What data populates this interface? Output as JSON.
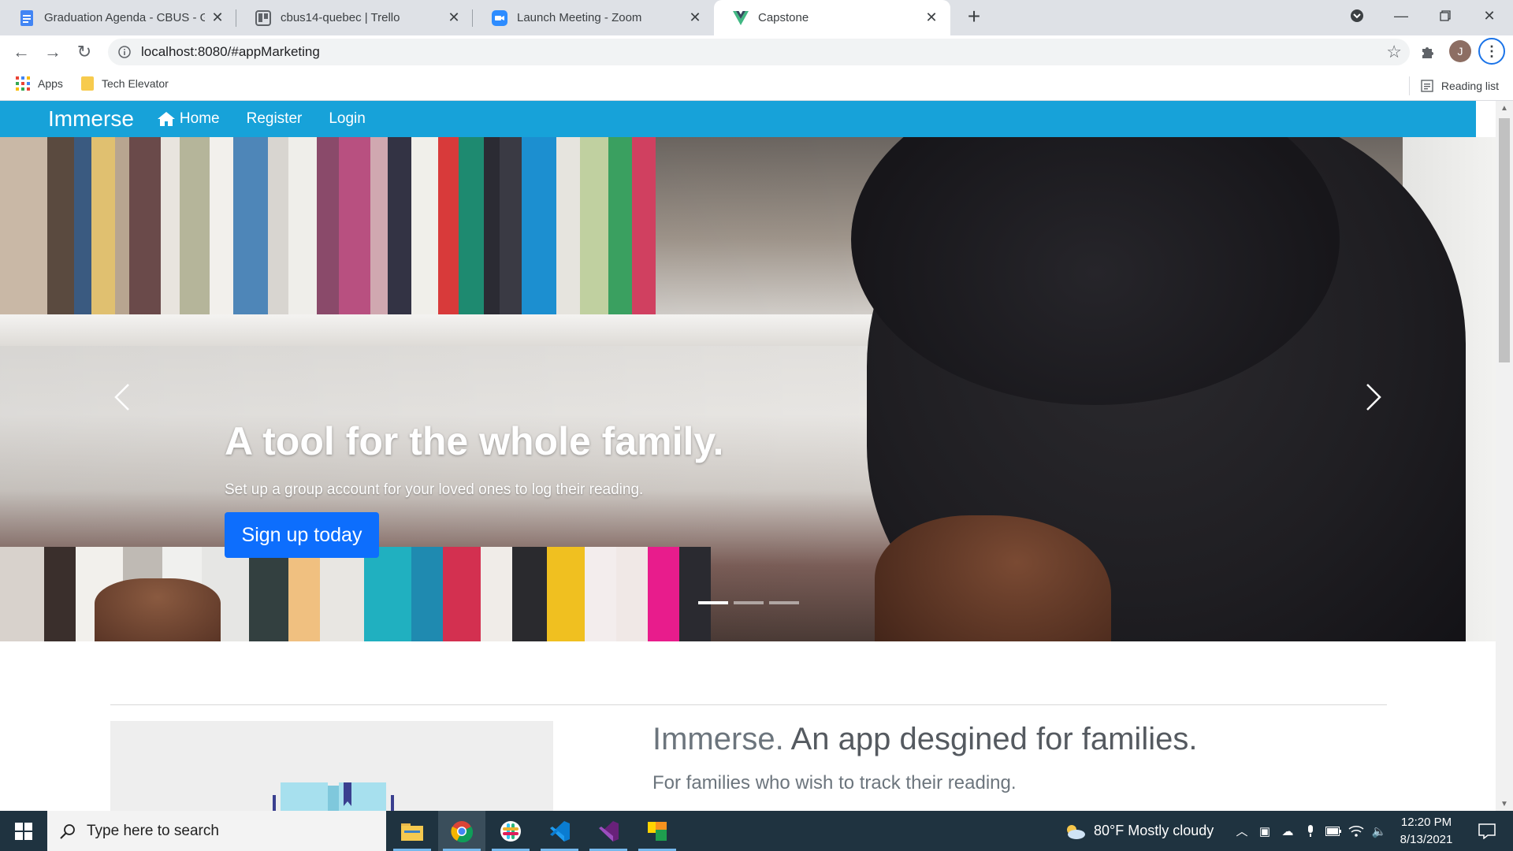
{
  "browser": {
    "tabs": [
      {
        "title": "Graduation Agenda - CBUS - Goo",
        "icon": "google-docs-icon"
      },
      {
        "title": "cbus14-quebec | Trello",
        "icon": "trello-icon"
      },
      {
        "title": "Launch Meeting - Zoom",
        "icon": "zoom-icon"
      },
      {
        "title": "Capstone",
        "icon": "vue-icon"
      }
    ],
    "new_tab": "+",
    "url": "localhost:8080/#appMarketing",
    "avatar_letter": "J",
    "bookmarks": [
      {
        "label": "Apps",
        "icon": "apps-grid-icon"
      },
      {
        "label": "Tech Elevator",
        "icon": "folder-icon"
      }
    ],
    "reading_list": "Reading list"
  },
  "app": {
    "brand": "Immerse",
    "nav": [
      {
        "label": "Home",
        "icon": "home-icon"
      },
      {
        "label": "Register"
      },
      {
        "label": "Login"
      }
    ],
    "hero": {
      "title": "A tool for the whole family.",
      "subtitle": "Set up a group account for your loved ones to log their reading.",
      "cta": "Sign up today",
      "slides": 3,
      "active_slide": 1
    },
    "feature": {
      "title_muted": "Immerse.",
      "title_main": "An app desgined for families.",
      "subtitle": "For families who wish to track their reading."
    }
  },
  "taskbar": {
    "search_placeholder": "Type here to search",
    "apps": [
      "file-explorer-icon",
      "chrome-icon",
      "slack-icon",
      "vscode-icon",
      "visual-studio-icon",
      "sticky-app-icon"
    ],
    "weather": "80°F  Mostly cloudy",
    "time": "12:20 PM",
    "date": "8/13/2021"
  },
  "colors": {
    "navbar": "#17a2d9",
    "button": "#0d6efd",
    "taskbar": "#1f3340"
  }
}
